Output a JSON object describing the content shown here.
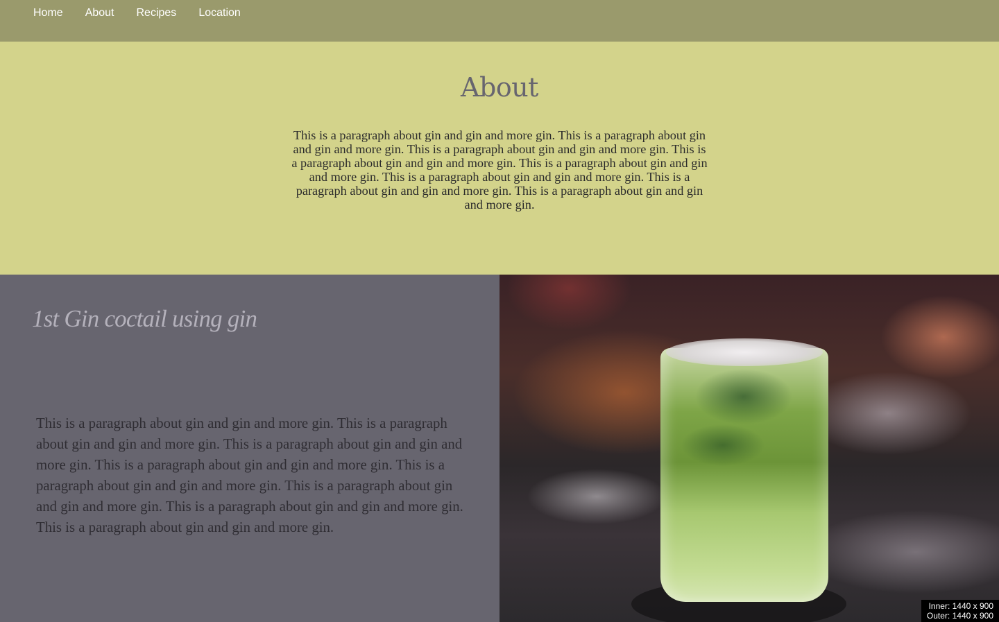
{
  "nav": {
    "items": [
      {
        "label": "Home"
      },
      {
        "label": "About"
      },
      {
        "label": "Recipes"
      },
      {
        "label": "Location"
      }
    ]
  },
  "about": {
    "title": "About",
    "paragraph": "This is a paragraph about gin and gin and more gin. This is a paragraph about gin and gin and more gin. This is a paragraph about gin and gin and more gin. This is a paragraph about gin and gin and more gin. This is a paragraph about gin and gin and more gin. This is a paragraph about gin and gin and more gin. This is a paragraph about gin and gin and more gin. This is a paragraph about gin and gin and more gin."
  },
  "recipe": {
    "title": "1st Gin coctail using gin",
    "paragraph": "This is a paragraph about gin and gin and more gin. This is a paragraph about gin and gin and more gin. This is a paragraph about gin and gin and more gin. This is a paragraph about gin and gin and more gin. This is a paragraph about gin and gin and more gin. This is a paragraph about gin and gin and more gin. This is a paragraph about gin and gin and more gin. This is a paragraph about gin and gin and more gin."
  },
  "viewport_badge": {
    "inner": "Inner: 1440 x 900",
    "outer": "Outer: 1440 x 900"
  },
  "colors": {
    "nav_bg": "#9a9a6c",
    "about_bg": "#d3d38b",
    "recipe_bg": "#67656f",
    "title_color": "#67656f"
  }
}
